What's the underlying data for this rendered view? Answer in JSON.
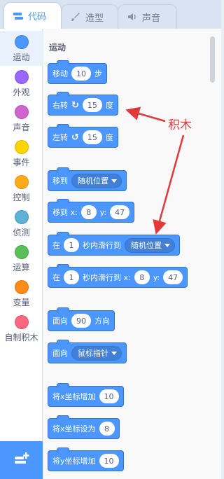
{
  "tabs": [
    {
      "label": "代码",
      "icon": "code-icon",
      "active": true
    },
    {
      "label": "造型",
      "icon": "brush-icon",
      "active": false
    },
    {
      "label": "声音",
      "icon": "speaker-icon",
      "active": false
    }
  ],
  "categories": [
    {
      "label": "运动",
      "color": "#4c97ff"
    },
    {
      "label": "外观",
      "color": "#9966ff"
    },
    {
      "label": "声音",
      "color": "#cf63cf"
    },
    {
      "label": "事件",
      "color": "#ffd500"
    },
    {
      "label": "控制",
      "color": "#ffab19"
    },
    {
      "label": "侦测",
      "color": "#5cb1d6"
    },
    {
      "label": "运算",
      "color": "#59c059"
    },
    {
      "label": "变量",
      "color": "#ff8c1a"
    },
    {
      "label": "自制积木",
      "color": "#ff6680"
    }
  ],
  "extension_button_icon": "add-extension-icon",
  "palette": {
    "section_title": "运动",
    "blocks": {
      "move": {
        "text": "移动",
        "value": "10",
        "unit": "步"
      },
      "turn_right": {
        "text": "右转",
        "value": "15",
        "unit": "度"
      },
      "turn_left": {
        "text": "左转",
        "value": "15",
        "unit": "度"
      },
      "goto": {
        "text": "移到",
        "option": "随机位置"
      },
      "goto_xy": {
        "text": "移到 x:",
        "x": "8",
        "y_label": "y:",
        "y": "47"
      },
      "glide_to": {
        "prefix": "在",
        "secs": "1",
        "text": "秒内滑行到",
        "option": "随机位置"
      },
      "glide_xy": {
        "prefix": "在",
        "secs": "1",
        "text": "秒内滑行到 x:",
        "x": "8",
        "y_label": "y:",
        "y": "47"
      },
      "point_dir": {
        "text": "面向",
        "value": "90",
        "unit": "方向"
      },
      "point_towards": {
        "text": "面向",
        "option": "鼠标指针"
      },
      "change_x": {
        "text": "将x坐标增加",
        "value": "10"
      },
      "set_x": {
        "text": "将x坐标设为",
        "value": "8"
      },
      "change_y": {
        "text": "将y坐标增加",
        "value": "10"
      }
    }
  },
  "annotation": {
    "label": "积木",
    "color": "#e03a3a"
  },
  "colors": {
    "motion": "#4c97ff",
    "motion_dark": "#3373cc",
    "accent": "#4c97ff"
  }
}
